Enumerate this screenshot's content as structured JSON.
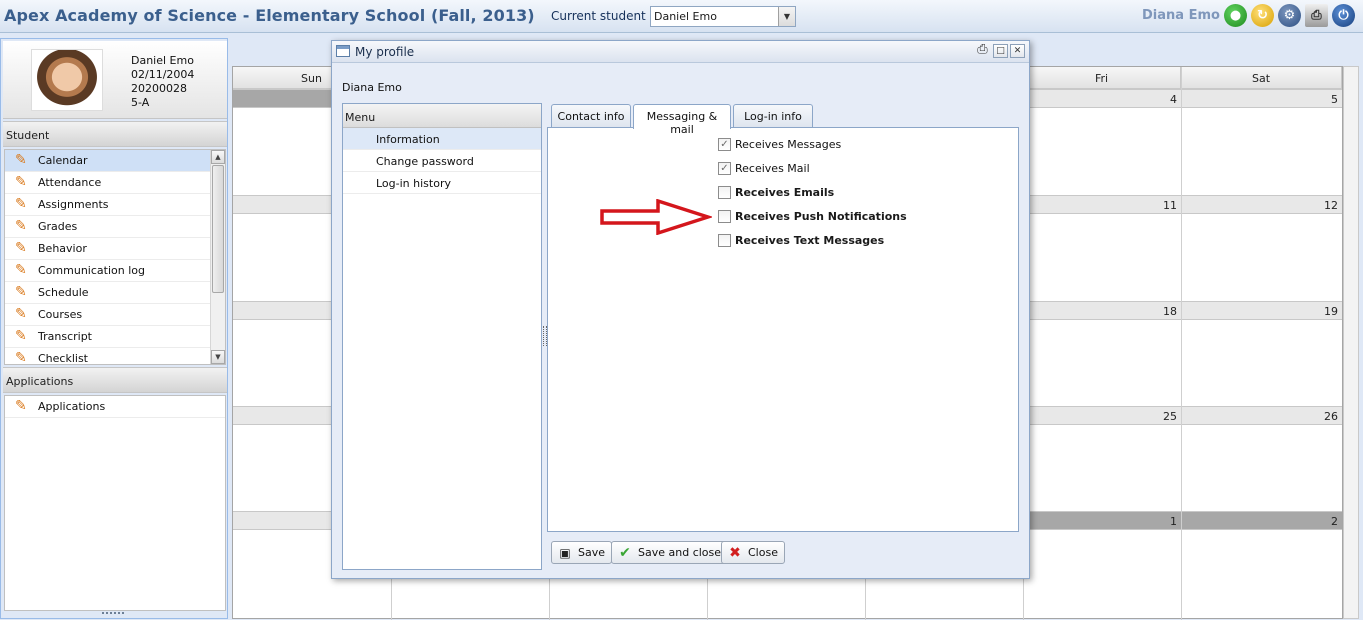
{
  "header": {
    "app_title": "Apex Academy of Science - Elementary School (Fall, 2013)",
    "current_student_label": "Current student :",
    "current_student_value": "Daniel Emo",
    "user_name": "Diana Emo",
    "icons": [
      "user-icon",
      "refresh-icon",
      "gear-icon",
      "print-icon",
      "power-icon"
    ]
  },
  "student_card": {
    "name": "Daniel Emo",
    "dob": "02/11/2004",
    "id": "20200028",
    "grade": "5-A"
  },
  "sidebar": {
    "student_section": "Student",
    "student_items": [
      {
        "label": "Calendar",
        "selected": true
      },
      {
        "label": "Attendance"
      },
      {
        "label": "Assignments"
      },
      {
        "label": "Grades"
      },
      {
        "label": "Behavior"
      },
      {
        "label": "Communication log"
      },
      {
        "label": "Schedule"
      },
      {
        "label": "Courses"
      },
      {
        "label": "Transcript"
      },
      {
        "label": "Checklist"
      }
    ],
    "applications_section": "Applications",
    "applications_items": [
      {
        "label": "Applications"
      }
    ]
  },
  "calendar": {
    "days": [
      "Sun",
      "Fri",
      "Sat"
    ],
    "weeks": [
      {
        "fri": "4",
        "sat": "5"
      },
      {
        "fri": "11",
        "sat": "12"
      },
      {
        "fri": "18",
        "sat": "19"
      },
      {
        "fri": "25",
        "sat": "26"
      },
      {
        "fri": "1",
        "sat": "2"
      }
    ]
  },
  "dialog": {
    "title": "My profile",
    "user": "Diana Emo",
    "menu_header": "Menu",
    "menu_items": [
      {
        "label": "Information",
        "selected": true
      },
      {
        "label": "Change password"
      },
      {
        "label": "Log-in history"
      }
    ],
    "tabs": [
      {
        "label": "Contact info"
      },
      {
        "label": "Messaging & mail",
        "active": true
      },
      {
        "label": "Log-in info"
      }
    ],
    "options": [
      {
        "label": "Receives Messages",
        "checked": true
      },
      {
        "label": "Receives Mail",
        "checked": true
      },
      {
        "label": "Receives Emails",
        "checked": false
      },
      {
        "label": "Receives Push Notifications",
        "checked": false
      },
      {
        "label": "Receives Text Messages",
        "checked": false
      }
    ],
    "buttons": {
      "save": "Save",
      "save_close": "Save and close",
      "close": "Close"
    }
  },
  "colors": {
    "title_blue": "#3b5f8d",
    "selection": "#cfe0f6",
    "arrow_red": "#d4161c"
  }
}
